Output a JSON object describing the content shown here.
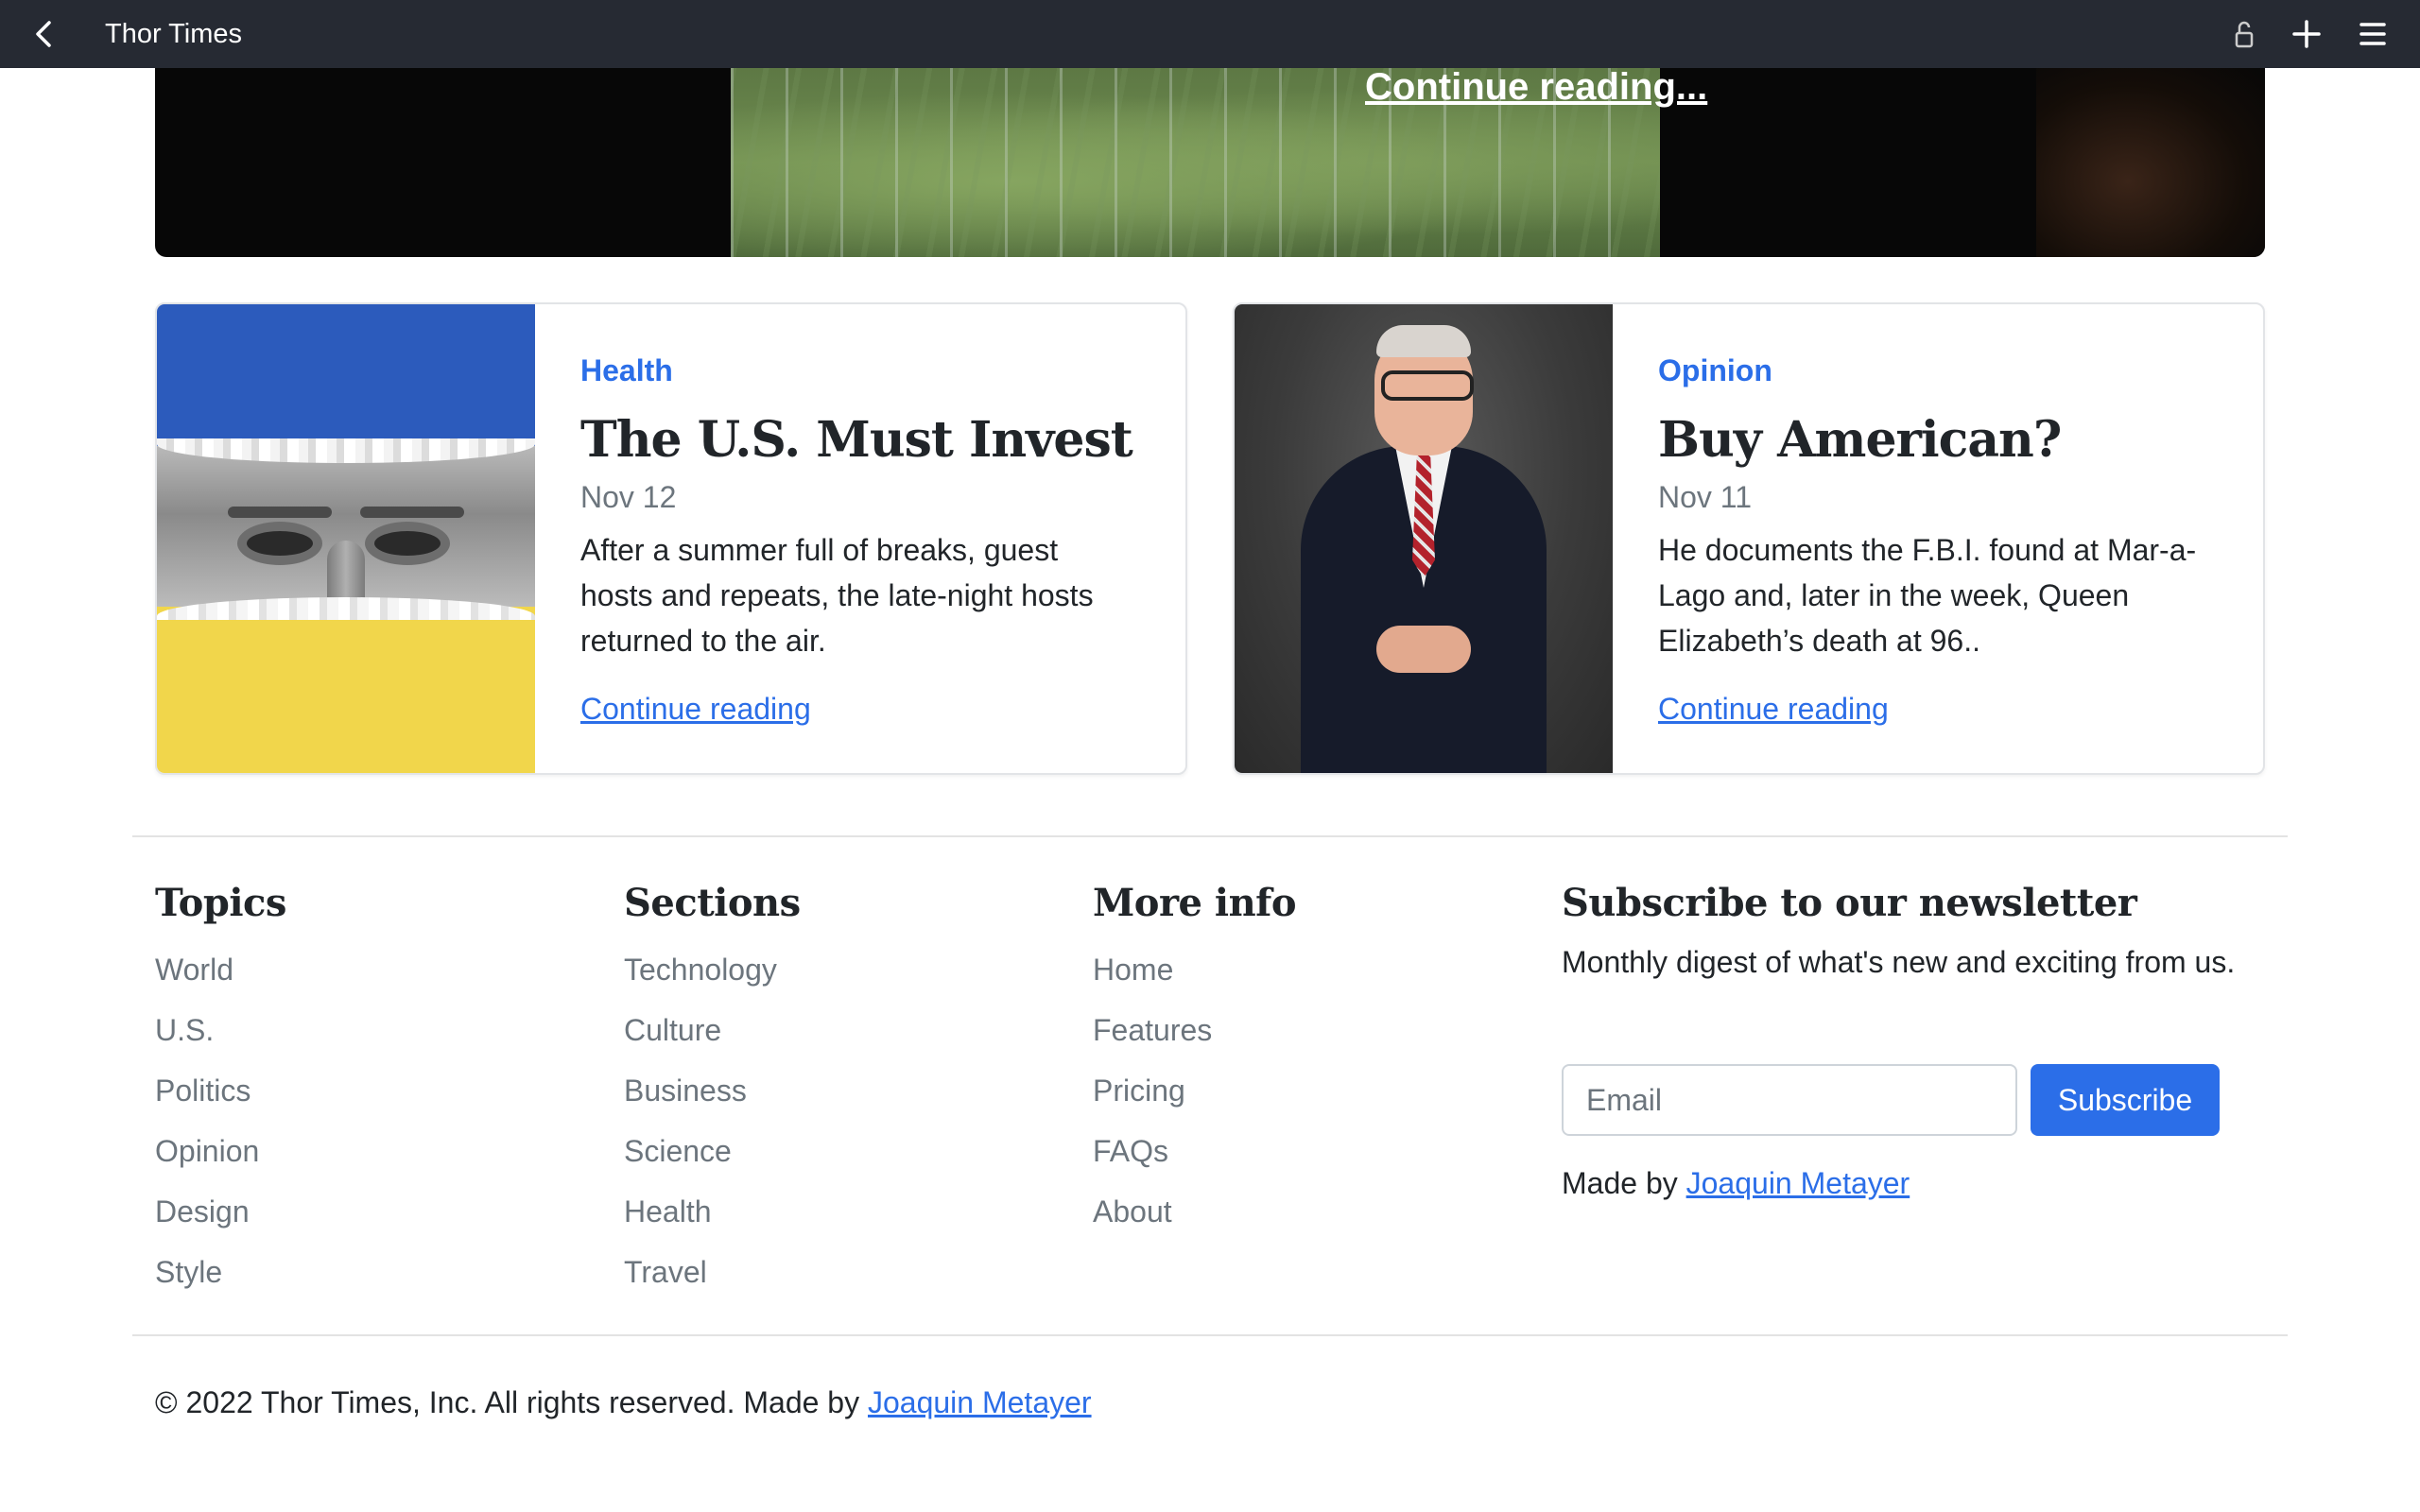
{
  "appbar": {
    "title": "Thor Times",
    "icons": [
      "back-arrow-icon",
      "lock-icon",
      "plus-icon",
      "menu-icon"
    ]
  },
  "hero": {
    "continue_label": "Continue reading..."
  },
  "cards": [
    {
      "category": "Health",
      "headline": "The U.S. Must Invest",
      "date": "Nov 12",
      "excerpt": "After a summer full of breaks, guest hosts and repeats, the late-night hosts returned to the air.",
      "link": "Continue reading"
    },
    {
      "category": "Opinion",
      "headline": "Buy American?",
      "date": "Nov 11",
      "excerpt": "He documents the F.B.I. found at Mar-a-Lago and, later in the week, Queen Elizabeth’s death at 96..",
      "link": "Continue reading"
    }
  ],
  "footer": {
    "topics": {
      "heading": "Topics",
      "items": [
        "World",
        "U.S.",
        "Politics",
        "Opinion",
        "Design",
        "Style"
      ]
    },
    "sections": {
      "heading": "Sections",
      "items": [
        "Technology",
        "Culture",
        "Business",
        "Science",
        "Health",
        "Travel"
      ]
    },
    "more_info": {
      "heading": "More info",
      "items": [
        "Home",
        "Features",
        "Pricing",
        "FAQs",
        "About"
      ]
    },
    "newsletter": {
      "heading": "Subscribe to our newsletter",
      "description": "Monthly digest of what's new and exciting from us.",
      "email_placeholder": "Email",
      "button": "Subscribe",
      "made_by_prefix": "Made by ",
      "made_by_name": "Joaquin Metayer"
    },
    "copyright_prefix": "© 2022 Thor Times, Inc. All rights reserved. Made by ",
    "copyright_name": "Joaquin Metayer"
  },
  "colors": {
    "appbar": "#262a33",
    "accent": "#2b6ee8",
    "muted": "#6c757d"
  }
}
